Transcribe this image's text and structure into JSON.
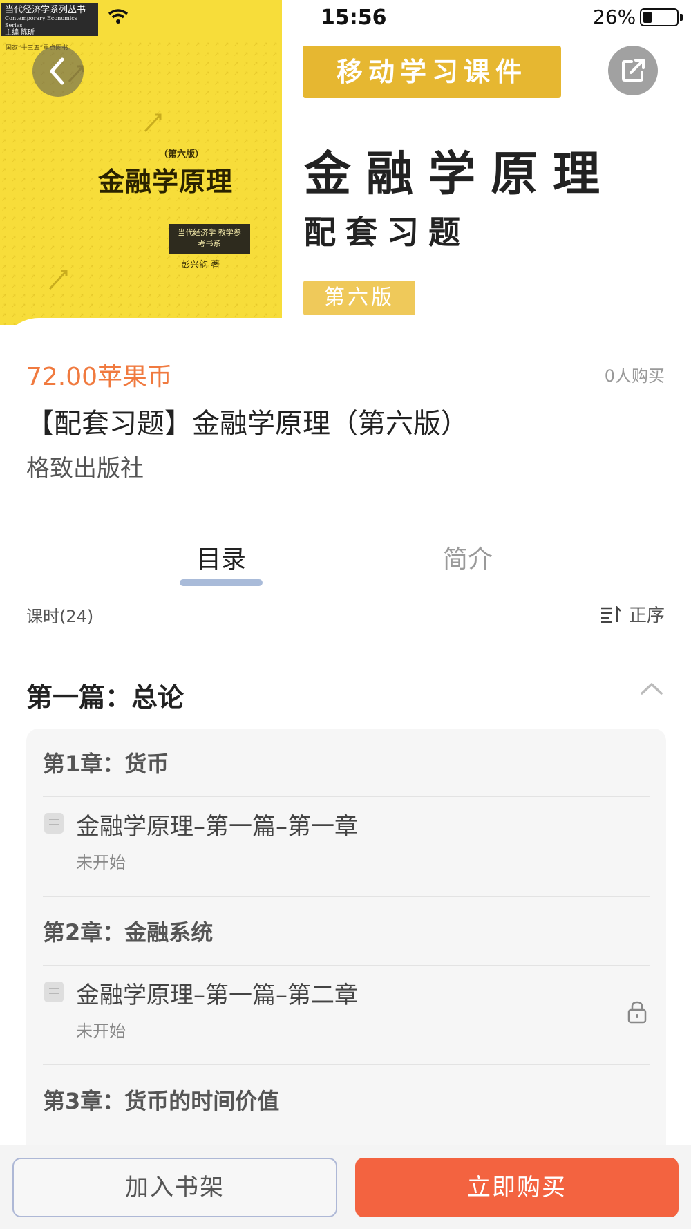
{
  "status_bar": {
    "time": "15:56",
    "battery": "26%"
  },
  "cover": {
    "series": "当代经济学系列丛书",
    "series_en": "Contemporary Economics Series",
    "editor": "主编 陈昕",
    "tag": "国家“十三五”重点图书",
    "edition": "（第六版）",
    "title": "金融学原理",
    "subtitle": "当代经济学 教学参考书系",
    "author": "彭兴韵 著"
  },
  "hero": {
    "badge": "移动学习课件",
    "title": "金融学原理",
    "subtitle": "配套习题",
    "edition": "第六版"
  },
  "info": {
    "price": "72.00苹果币",
    "buyers": "0人购买",
    "title": "【配套习题】金融学原理（第六版）",
    "publisher": "格致出版社"
  },
  "tabs": [
    {
      "label": "目录",
      "active": true
    },
    {
      "label": "简介",
      "active": false
    }
  ],
  "toc": {
    "lesson_count": "课时(24)",
    "order_label": "正序",
    "part_title": "第一篇：总论",
    "chapters": [
      {
        "title": "第1章：货币",
        "lesson": "金融学原理–第一篇–第一章",
        "status": "未开始",
        "locked": false
      },
      {
        "title": "第2章：金融系统",
        "lesson": "金融学原理–第一篇–第二章",
        "status": "未开始",
        "locked": true
      },
      {
        "title": "第3章：货币的时间价值"
      }
    ]
  },
  "bottom": {
    "shelf_label": "加入书架",
    "buy_label": "立即购买"
  },
  "colors": {
    "price": "#f07a3f",
    "buy": "#f36340",
    "badge": "#e6b731",
    "cover": "#f7dd3a",
    "tab_indicator": "#a9bbd9"
  },
  "icons": [
    "back-icon",
    "share-icon",
    "wifi-icon",
    "battery-icon",
    "sort-icon",
    "chevron-up-icon",
    "document-icon",
    "lock-icon"
  ]
}
